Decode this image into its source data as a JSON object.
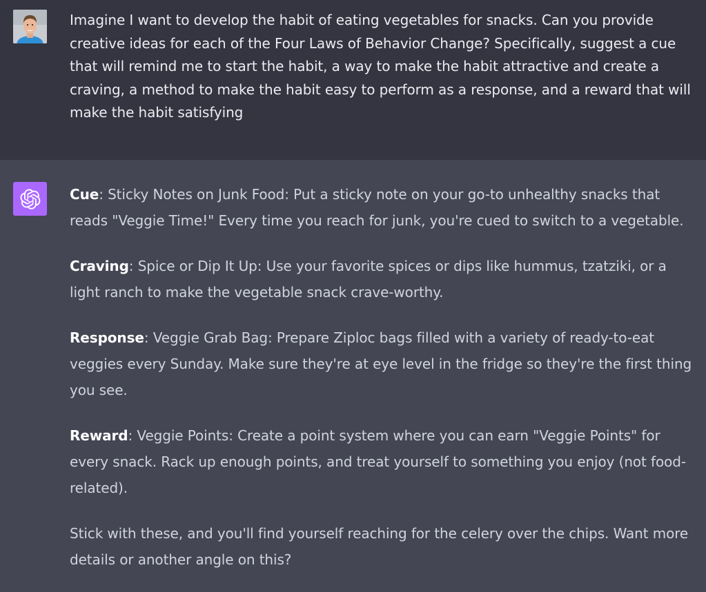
{
  "user_message": {
    "text": "Imagine I want to develop the habit of eating vegetables for snacks. Can you provide creative ideas for each of the Four Laws of Behavior Change? Specifically, suggest a cue that will remind me to start the habit, a way to make the habit attractive and create a craving, a method to make the habit easy to perform as a response, and a reward that will make the habit satisfying"
  },
  "assistant_message": {
    "paragraphs": [
      {
        "label": "Cue",
        "text": ": Sticky Notes on Junk Food: Put a sticky note on your go-to unhealthy snacks that reads \"Veggie Time!\" Every time you reach for junk, you're cued to switch to a vegetable."
      },
      {
        "label": "Craving",
        "text": ": Spice or Dip It Up: Use your favorite spices or dips like hummus, tzatziki, or a light ranch to make the vegetable snack crave-worthy."
      },
      {
        "label": "Response",
        "text": ": Veggie Grab Bag: Prepare Ziploc bags filled with a variety of ready-to-eat veggies every Sunday. Make sure they're at eye level in the fridge so they're the first thing you see."
      },
      {
        "label": "Reward",
        "text": ": Veggie Points: Create a point system where you can earn \"Veggie Points\" for every snack. Rack up enough points, and treat yourself to something you enjoy (not food-related)."
      }
    ],
    "closing": "Stick with these, and you'll find yourself reaching for the celery over the chips. Want more details or another angle on this?"
  },
  "icons": {
    "user_avatar": "user-photo-avatar",
    "assistant_avatar": "openai-logo-icon"
  },
  "colors": {
    "user_bg": "#343541",
    "assistant_bg": "#444654",
    "gpt_avatar_bg": "#ab68ff",
    "user_text": "#ececf1",
    "assistant_text": "#d1d5db"
  }
}
